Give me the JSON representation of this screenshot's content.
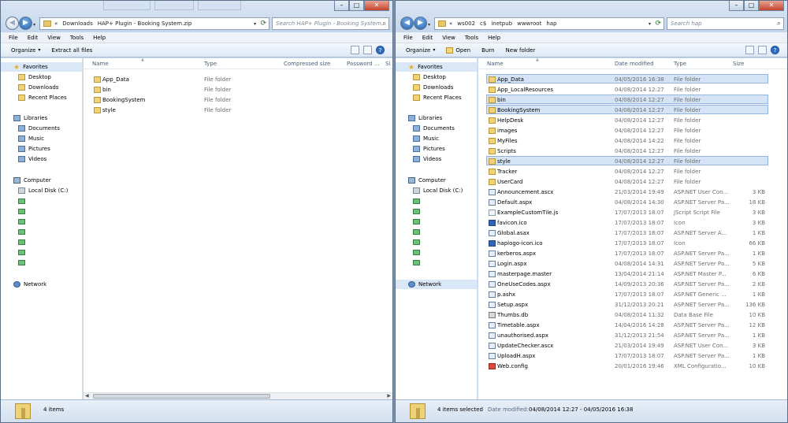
{
  "left_window": {
    "crumbs": [
      "«",
      "Downloads",
      "HAP+ Plugin - Booking System.zip"
    ],
    "search_placeholder": "Search HAP+ Plugin - Booking System...",
    "menu": [
      "File",
      "Edit",
      "View",
      "Tools",
      "Help"
    ],
    "toolbar": {
      "organize": "Organize",
      "extract": "Extract all files"
    },
    "columns": {
      "name": "Name",
      "type": "Type",
      "compressed": "Compressed size",
      "password": "Password ...",
      "size": "Si"
    },
    "nav": {
      "favorites": "Favorites",
      "desktop": "Desktop",
      "downloads": "Downloads",
      "recent": "Recent Places",
      "libraries": "Libraries",
      "documents": "Documents",
      "music": "Music",
      "pictures": "Pictures",
      "videos": "Videos",
      "computer": "Computer",
      "local_disk": "Local Disk (C:)",
      "network": "Network"
    },
    "files": [
      {
        "name": "App_Data",
        "type": "File folder",
        "icon": "folder-icon"
      },
      {
        "name": "bin",
        "type": "File folder",
        "icon": "folder-icon"
      },
      {
        "name": "BookingSystem",
        "type": "File folder",
        "icon": "folder-icon"
      },
      {
        "name": "style",
        "type": "File folder",
        "icon": "folder-icon"
      }
    ],
    "status": "4 items"
  },
  "right_window": {
    "crumbs": [
      "«",
      "ws002",
      "c$",
      "inetpub",
      "wwwroot",
      "hap"
    ],
    "search_placeholder": "Search hap",
    "menu": [
      "File",
      "Edit",
      "View",
      "Tools",
      "Help"
    ],
    "toolbar": {
      "organize": "Organize",
      "open": "Open",
      "burn": "Burn",
      "new_folder": "New folder"
    },
    "columns": {
      "name": "Name",
      "date": "Date modified",
      "type": "Type",
      "size": "Size"
    },
    "nav": {
      "favorites": "Favorites",
      "desktop": "Desktop",
      "downloads": "Downloads",
      "recent": "Recent Places",
      "libraries": "Libraries",
      "documents": "Documents",
      "music": "Music",
      "pictures": "Pictures",
      "videos": "Videos",
      "computer": "Computer",
      "local_disk": "Local Disk (C:)",
      "network": "Network"
    },
    "files": [
      {
        "name": "App_Data",
        "date": "04/05/2016 16:38",
        "type": "File folder",
        "size": "",
        "selected": true,
        "icon": "folder-icon"
      },
      {
        "name": "App_LocalResources",
        "date": "04/08/2014 12:27",
        "type": "File folder",
        "size": "",
        "selected": false,
        "icon": "folder-icon"
      },
      {
        "name": "bin",
        "date": "04/08/2014 12:27",
        "type": "File folder",
        "size": "",
        "selected": true,
        "icon": "folder-icon"
      },
      {
        "name": "BookingSystem",
        "date": "04/08/2014 12:27",
        "type": "File folder",
        "size": "",
        "selected": true,
        "icon": "folder-icon"
      },
      {
        "name": "HelpDesk",
        "date": "04/08/2014 12:27",
        "type": "File folder",
        "size": "",
        "selected": false,
        "icon": "folder-icon"
      },
      {
        "name": "images",
        "date": "04/08/2014 12:27",
        "type": "File folder",
        "size": "",
        "selected": false,
        "icon": "folder-icon"
      },
      {
        "name": "MyFiles",
        "date": "04/08/2014 14:22",
        "type": "File folder",
        "size": "",
        "selected": false,
        "icon": "folder-icon"
      },
      {
        "name": "Scripts",
        "date": "04/08/2014 12:27",
        "type": "File folder",
        "size": "",
        "selected": false,
        "icon": "folder-icon"
      },
      {
        "name": "style",
        "date": "04/08/2014 12:27",
        "type": "File folder",
        "size": "",
        "selected": true,
        "icon": "folder-icon"
      },
      {
        "name": "Tracker",
        "date": "04/08/2014 12:27",
        "type": "File folder",
        "size": "",
        "selected": false,
        "icon": "folder-icon"
      },
      {
        "name": "UserCard",
        "date": "04/08/2014 12:27",
        "type": "File folder",
        "size": "",
        "selected": false,
        "icon": "folder-icon"
      },
      {
        "name": "Announcement.ascx",
        "date": "21/03/2014 19:49",
        "type": "ASP.NET User Con...",
        "size": "3 KB",
        "selected": false,
        "icon": "aspx-icon"
      },
      {
        "name": "Default.aspx",
        "date": "04/08/2014 14:30",
        "type": "ASP.NET Server Pa...",
        "size": "18 KB",
        "selected": false,
        "icon": "aspx-icon"
      },
      {
        "name": "ExampleCustomTile.js",
        "date": "17/07/2013 18:07",
        "type": "JScript Script File",
        "size": "3 KB",
        "selected": false,
        "icon": "file-icon"
      },
      {
        "name": "favicon.ico",
        "date": "17/07/2013 18:07",
        "type": "Icon",
        "size": "3 KB",
        "selected": false,
        "icon": "blue-icon"
      },
      {
        "name": "Global.asax",
        "date": "17/07/2013 18:07",
        "type": "ASP.NET Server A...",
        "size": "1 KB",
        "selected": false,
        "icon": "aspx-icon"
      },
      {
        "name": "haplogo-icon.ico",
        "date": "17/07/2013 18:07",
        "type": "Icon",
        "size": "66 KB",
        "selected": false,
        "icon": "blue-icon"
      },
      {
        "name": "kerberos.aspx",
        "date": "17/07/2013 18:07",
        "type": "ASP.NET Server Pa...",
        "size": "1 KB",
        "selected": false,
        "icon": "aspx-icon"
      },
      {
        "name": "Login.aspx",
        "date": "04/08/2014 14:31",
        "type": "ASP.NET Server Pa...",
        "size": "5 KB",
        "selected": false,
        "icon": "aspx-icon"
      },
      {
        "name": "masterpage.master",
        "date": "13/04/2014 21:14",
        "type": "ASP.NET Master P...",
        "size": "6 KB",
        "selected": false,
        "icon": "aspx-icon"
      },
      {
        "name": "OneUseCodes.aspx",
        "date": "14/09/2013 20:36",
        "type": "ASP.NET Server Pa...",
        "size": "2 KB",
        "selected": false,
        "icon": "aspx-icon"
      },
      {
        "name": "p.ashx",
        "date": "17/07/2013 18:07",
        "type": "ASP.NET Generic ...",
        "size": "1 KB",
        "selected": false,
        "icon": "aspx-icon"
      },
      {
        "name": "Setup.aspx",
        "date": "31/12/2013 20:21",
        "type": "ASP.NET Server Pa...",
        "size": "136 KB",
        "selected": false,
        "icon": "aspx-icon"
      },
      {
        "name": "Thumbs.db",
        "date": "04/08/2014 11:32",
        "type": "Data Base File",
        "size": "10 KB",
        "selected": false,
        "icon": "db-icon"
      },
      {
        "name": "Timetable.aspx",
        "date": "14/04/2016 14:28",
        "type": "ASP.NET Server Pa...",
        "size": "12 KB",
        "selected": false,
        "icon": "aspx-icon"
      },
      {
        "name": "unauthorised.aspx",
        "date": "31/12/2013 21:54",
        "type": "ASP.NET Server Pa...",
        "size": "1 KB",
        "selected": false,
        "icon": "aspx-icon"
      },
      {
        "name": "UpdateChecker.ascx",
        "date": "21/03/2014 19:49",
        "type": "ASP.NET User Con...",
        "size": "3 KB",
        "selected": false,
        "icon": "aspx-icon"
      },
      {
        "name": "UploadH.aspx",
        "date": "17/07/2013 18:07",
        "type": "ASP.NET Server Pa...",
        "size": "1 KB",
        "selected": false,
        "icon": "aspx-icon"
      },
      {
        "name": "Web.config",
        "date": "20/01/2016 19:46",
        "type": "XML Configuratio...",
        "size": "10 KB",
        "selected": false,
        "icon": "red-icon"
      }
    ],
    "status_selected": "4 items selected",
    "status_date_label": "Date modified:",
    "status_date_value": "04/08/2014 12:27 - 04/05/2016 16:38"
  },
  "window_buttons": {
    "minimize": "–",
    "maximize": "□",
    "close": "✕"
  },
  "icons": {
    "back": "◀",
    "forward": "▶",
    "refresh": "⟳",
    "search": "⌕",
    "help": "?",
    "star": "★",
    "dropdown": "▾"
  }
}
